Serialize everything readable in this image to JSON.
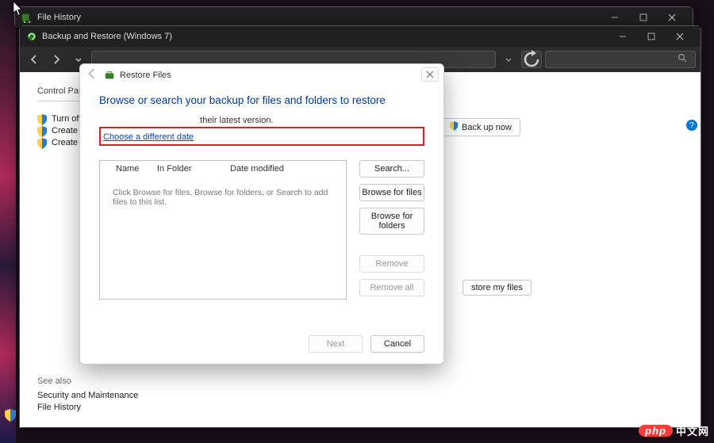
{
  "bg_window": {
    "title": "File History"
  },
  "control_panel": {
    "title": "Backup and Restore (Windows 7)",
    "breadcrumb": "Control Panel",
    "tasks": {
      "off_schedule": "Turn off sche",
      "create_sys1": "Create a syste",
      "create_sys2": "Create a syste"
    },
    "backup_now": "Back up now",
    "restore_my_files_fragment": "store my files",
    "see_also": {
      "header": "See also",
      "sec_maint": "Security and Maintenance",
      "file_history": "File History"
    },
    "help_badge": "?"
  },
  "dialog": {
    "header_text": "Restore Files",
    "heading": "Browse or search your backup for files and folders to restore",
    "line_fragment": "their latest version.",
    "choose_date": "Choose a different date",
    "columns": {
      "name": "Name",
      "in_folder": "In Folder",
      "date_modified": "Date modified"
    },
    "hint": "Click Browse for files, Browse for folders, or Search to add files to this list.",
    "buttons": {
      "search": "Search...",
      "browse_files": "Browse for files",
      "browse_folders": "Browse for folders",
      "remove": "Remove",
      "remove_all": "Remove all",
      "next": "Next",
      "cancel": "Cancel"
    }
  },
  "watermark": {
    "brand": "php",
    "text": "中文网"
  }
}
